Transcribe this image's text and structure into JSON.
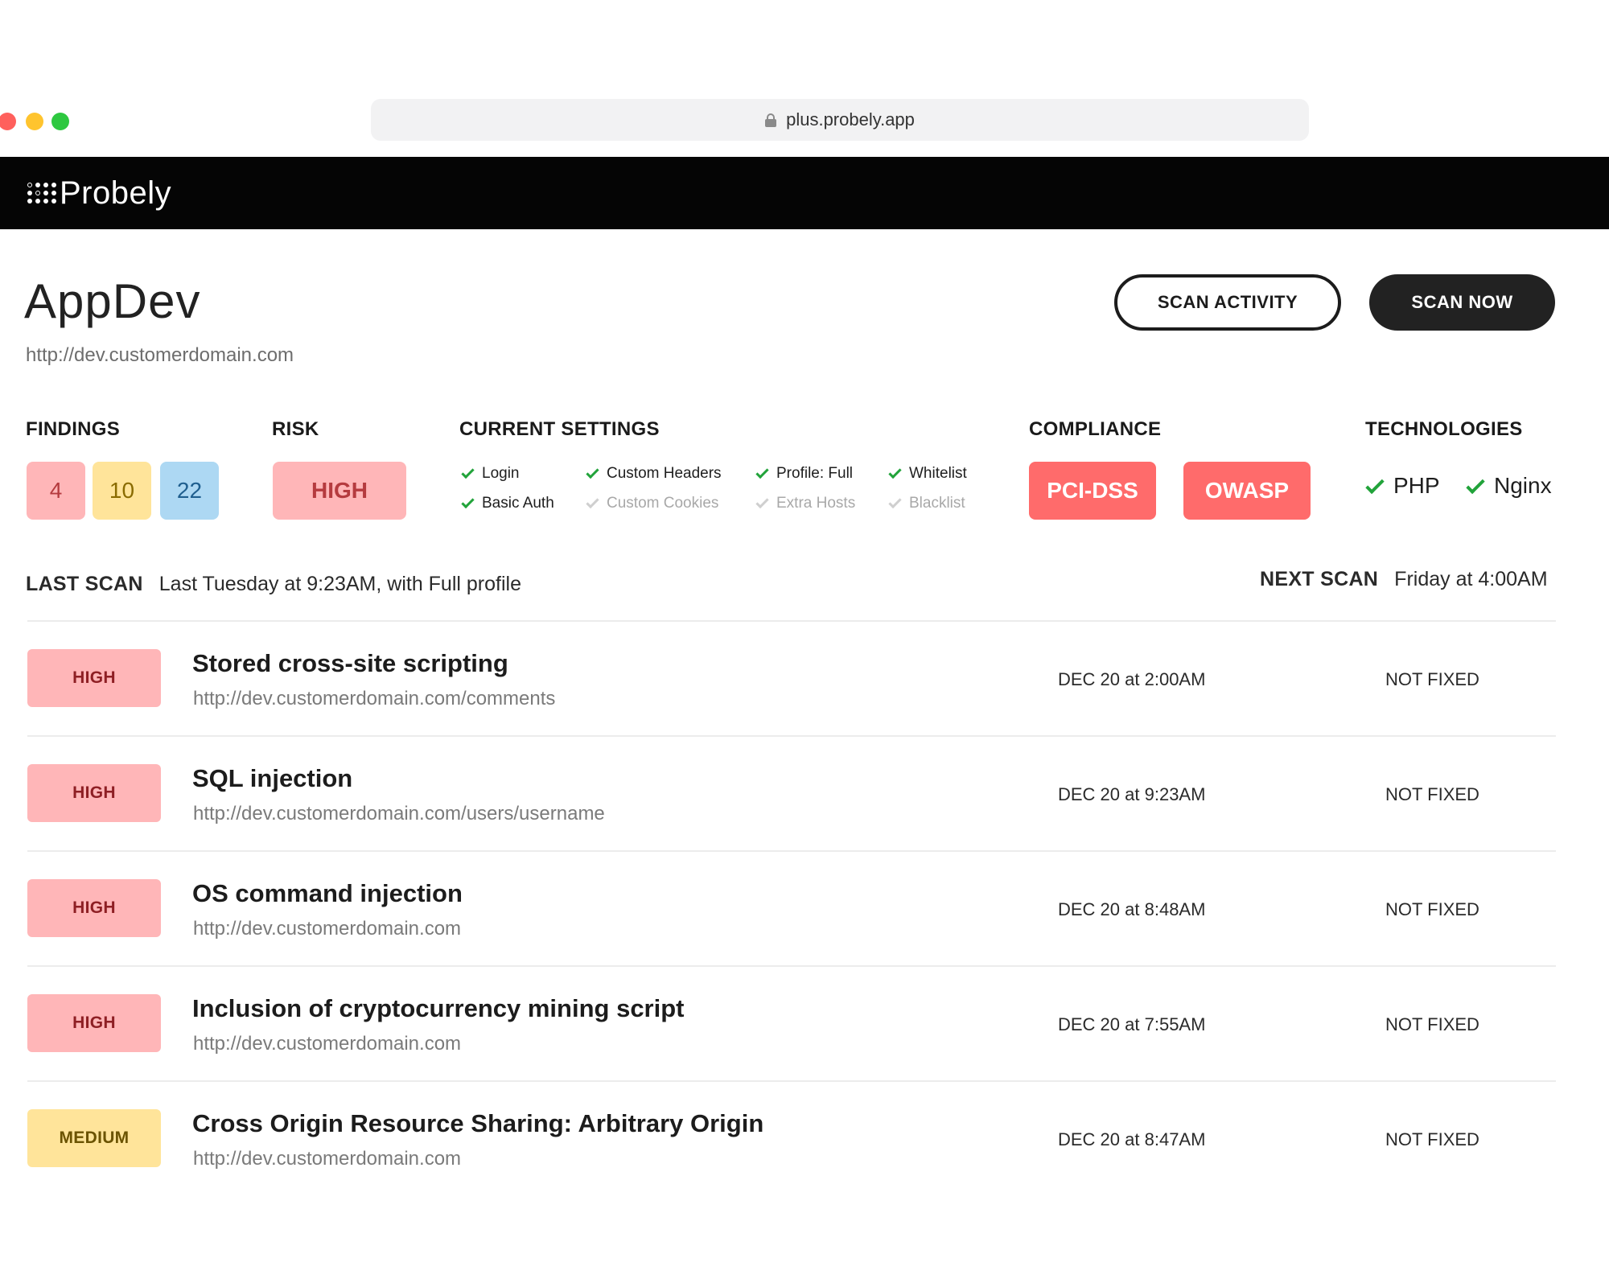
{
  "browser": {
    "url": "plus.probely.app"
  },
  "app": {
    "logo_text": "Probely"
  },
  "target": {
    "name": "AppDev",
    "url": "http://dev.customerdomain.com"
  },
  "actions": {
    "scan_activity": "SCAN ACTIVITY",
    "scan_now": "SCAN NOW"
  },
  "summary": {
    "findings_label": "FINDINGS",
    "findings": {
      "high": "4",
      "medium": "10",
      "low": "22"
    },
    "risk_label": "RISK",
    "risk": "HIGH",
    "settings_label": "CURRENT SETTINGS",
    "settings": [
      {
        "label": "Login",
        "enabled": true
      },
      {
        "label": "Basic Auth",
        "enabled": true
      },
      {
        "label": "Custom Headers",
        "enabled": true
      },
      {
        "label": "Custom Cookies",
        "enabled": false
      },
      {
        "label": "Profile: Full",
        "enabled": true
      },
      {
        "label": "Extra Hosts",
        "enabled": false
      },
      {
        "label": "Whitelist",
        "enabled": true
      },
      {
        "label": "Blacklist",
        "enabled": false
      }
    ],
    "compliance_label": "COMPLIANCE",
    "compliance": [
      "PCI-DSS",
      "OWASP"
    ],
    "technologies_label": "TECHNOLOGIES",
    "technologies": [
      "PHP",
      "Nginx"
    ]
  },
  "scans": {
    "last_label": "LAST SCAN",
    "last_value": "Last Tuesday at 9:23AM, with Full profile",
    "next_label": "NEXT SCAN",
    "next_value": "Friday at 4:00AM"
  },
  "colors": {
    "high_bg": "#ffb6b8",
    "medium_bg": "#ffe49a",
    "low_bg": "#add8f3",
    "compliance_bg": "#ff6b6b",
    "check_green": "#21a33a"
  },
  "findings_list": [
    {
      "severity": "HIGH",
      "title": "Stored cross-site scripting",
      "url": "http://dev.customerdomain.com/comments",
      "date": "DEC 20 at 2:00AM",
      "status": "NOT FIXED"
    },
    {
      "severity": "HIGH",
      "title": "SQL injection",
      "url": "http://dev.customerdomain.com/users/username",
      "date": "DEC 20 at 9:23AM",
      "status": "NOT FIXED"
    },
    {
      "severity": "HIGH",
      "title": "OS command injection",
      "url": "http://dev.customerdomain.com",
      "date": "DEC 20 at 8:48AM",
      "status": "NOT FIXED"
    },
    {
      "severity": "HIGH",
      "title": "Inclusion of cryptocurrency mining script",
      "url": "http://dev.customerdomain.com",
      "date": "DEC 20 at 7:55AM",
      "status": "NOT FIXED"
    },
    {
      "severity": "MEDIUM",
      "title": "Cross Origin Resource Sharing: Arbitrary Origin",
      "url": "http://dev.customerdomain.com",
      "date": "DEC 20 at 8:47AM",
      "status": "NOT FIXED"
    }
  ]
}
